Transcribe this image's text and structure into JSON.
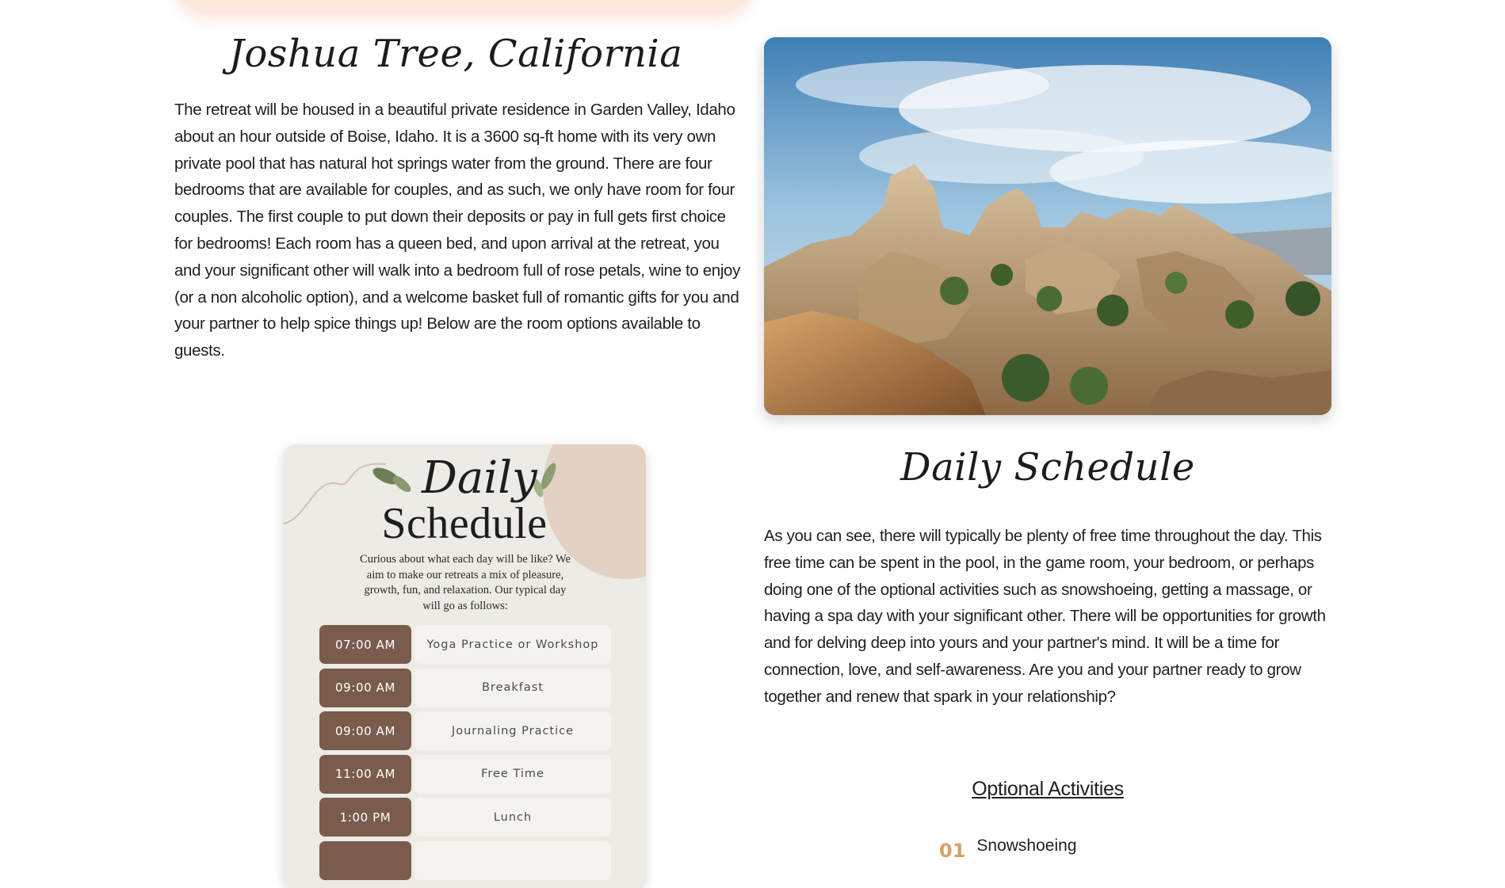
{
  "location": {
    "title": "Joshua Tree, California",
    "description": "The retreat will be housed in a beautiful private residence in Garden Valley, Idaho about an hour outside of Boise, Idaho. It is a 3600 sq-ft home with its very own private pool that has natural hot springs water from the ground. There are four bedrooms that are available for couples, and as such, we only have room for four couples. The first couple to put down their deposits or pay in full gets first choice for bedrooms! Each room has a queen bed, and upon arrival at the retreat, you and your significant other will walk into a bedroom full of rose petals, wine to enjoy (or a non alcoholic option), and a welcome basket full of romantic gifts for you and your partner to help spice things up! Below are the room options available to guests."
  },
  "schedule_card": {
    "script_word": "Daily",
    "heading": "Schedule",
    "intro": "Curious about what each day will be like? We aim to make our retreats a mix of pleasure, growth, fun, and relaxation. Our typical day will go as follows:",
    "items": [
      {
        "time": "07:00 AM",
        "activity": "Yoga Practice or Workshop"
      },
      {
        "time": "09:00 AM",
        "activity": "Breakfast"
      },
      {
        "time": "09:00 AM",
        "activity": "Journaling Practice"
      },
      {
        "time": "11:00 AM",
        "activity": "Free Time"
      },
      {
        "time": "1:00 PM",
        "activity": "Lunch"
      },
      {
        "time": "",
        "activity": ""
      }
    ]
  },
  "schedule": {
    "title": "Daily Schedule",
    "description": "As you can see, there will typically be plenty of free time throughout the day. This free time can be spent in the pool, in the game room, your bedroom, or perhaps doing one of the optional activities such as snowshoeing, getting a massage, or having a spa day with your significant other. There will be opportunities for growth and for delving deep into yours and your partner's mind. It will be a time for connection, love, and self-awareness. Are you and your partner ready to grow together and renew that spark in your relationship?"
  },
  "optional_activities": {
    "heading": "Optional Activities",
    "items": [
      {
        "number": "01",
        "label": "Snowshoeing"
      }
    ]
  },
  "colors": {
    "time_badge": "#7a5c4c",
    "activity_number": "#d5a26a",
    "card_background": "#ecebe6"
  }
}
